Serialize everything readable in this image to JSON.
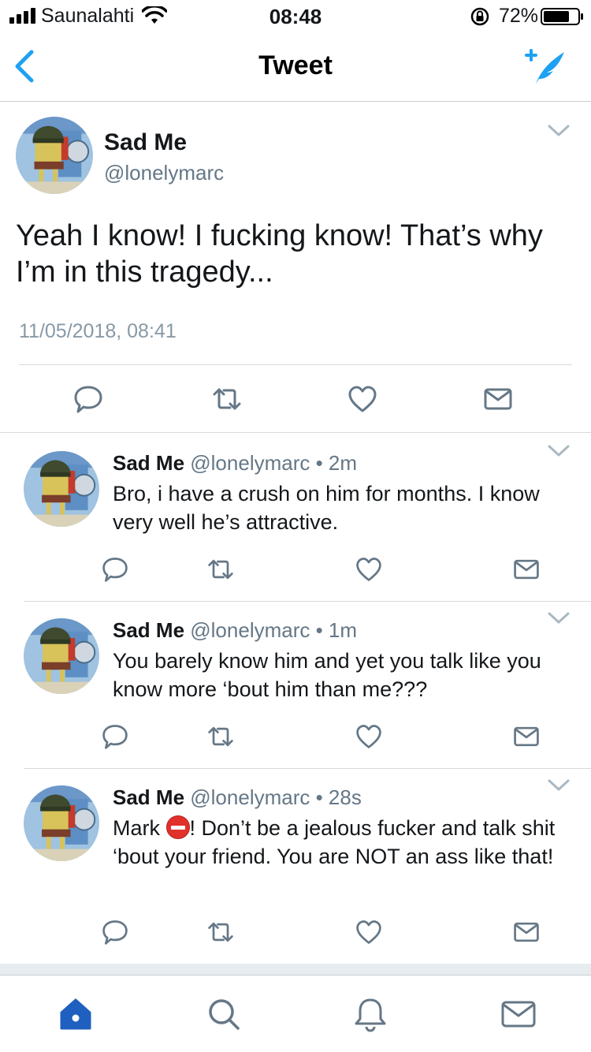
{
  "status_bar": {
    "carrier": "Saunalahti",
    "time": "08:48",
    "battery_percent": "72%"
  },
  "nav": {
    "title": "Tweet"
  },
  "main_tweet": {
    "name": "Sad Me",
    "handle": "@lonelymarc",
    "text": "Yeah I know! I fucking know! That’s why I’m in this tragedy...",
    "timestamp": "11/05/2018, 08:41"
  },
  "replies": [
    {
      "name": "Sad Me",
      "meta": "@lonelymarc • 2m",
      "text": "Bro, i have a crush on him for months. I know very well he’s attractive."
    },
    {
      "name": "Sad Me",
      "meta": "@lonelymarc • 1m",
      "text": "You barely know him and yet you talk like you know more ‘bout him than me???"
    },
    {
      "name": "Sad Me",
      "meta": "@lonelymarc • 28s",
      "text_before": "Mark ",
      "text_after": "! Don’t be a jealous fucker and talk shit ‘bout your friend. You are NOT an ass like that!"
    }
  ],
  "icons": {
    "accent": "#1da1f2",
    "icon_gray": "#657786",
    "main_actions": [
      "reply-icon",
      "retweet-icon",
      "like-icon",
      "dm-icon"
    ],
    "tabs": [
      "home-icon",
      "search-icon",
      "notifications-icon",
      "messages-icon"
    ]
  }
}
